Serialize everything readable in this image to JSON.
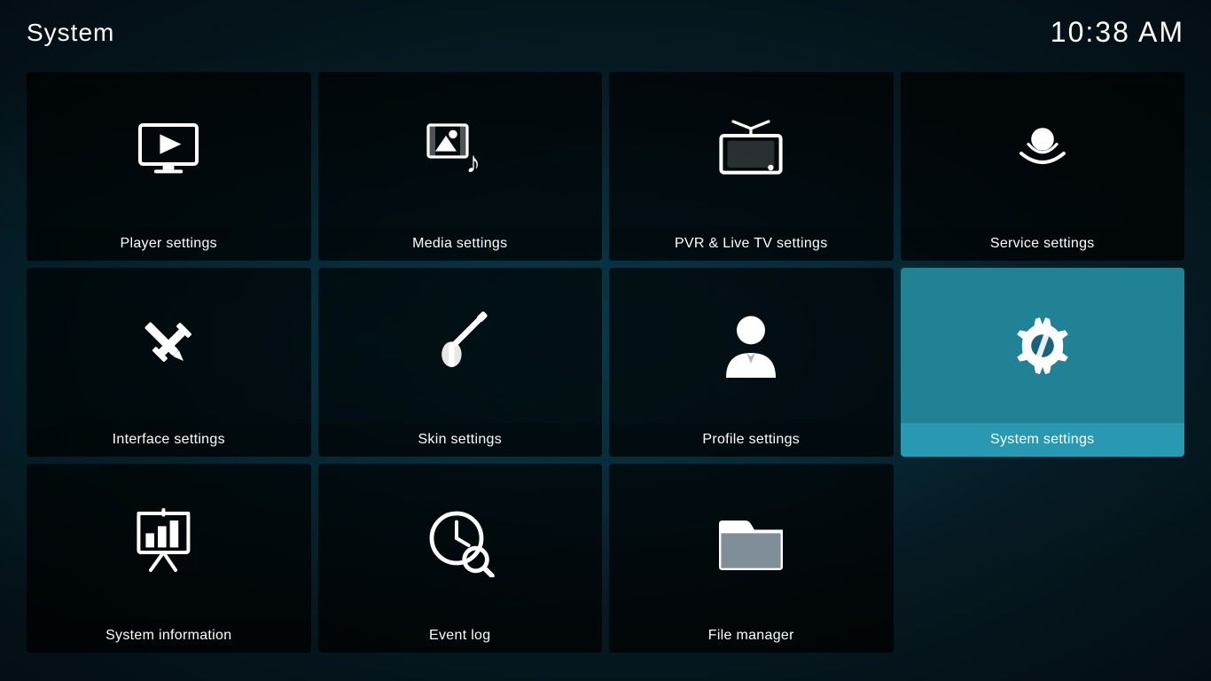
{
  "header": {
    "title": "System",
    "time": "10:38 AM"
  },
  "grid": {
    "items": [
      {
        "id": "player-settings",
        "label": "Player settings",
        "icon": "player",
        "active": false,
        "row": 1,
        "col": 1
      },
      {
        "id": "media-settings",
        "label": "Media settings",
        "icon": "media",
        "active": false,
        "row": 1,
        "col": 2
      },
      {
        "id": "pvr-settings",
        "label": "PVR & Live TV settings",
        "icon": "pvr",
        "active": false,
        "row": 1,
        "col": 3
      },
      {
        "id": "service-settings",
        "label": "Service settings",
        "icon": "service",
        "active": false,
        "row": 1,
        "col": 4
      },
      {
        "id": "interface-settings",
        "label": "Interface settings",
        "icon": "interface",
        "active": false,
        "row": 2,
        "col": 1
      },
      {
        "id": "skin-settings",
        "label": "Skin settings",
        "icon": "skin",
        "active": false,
        "row": 2,
        "col": 2
      },
      {
        "id": "profile-settings",
        "label": "Profile settings",
        "icon": "profile",
        "active": false,
        "row": 2,
        "col": 3
      },
      {
        "id": "system-settings",
        "label": "System settings",
        "icon": "system",
        "active": true,
        "row": 2,
        "col": 4
      },
      {
        "id": "system-information",
        "label": "System information",
        "icon": "information",
        "active": false,
        "row": 3,
        "col": 1
      },
      {
        "id": "event-log",
        "label": "Event log",
        "icon": "eventlog",
        "active": false,
        "row": 3,
        "col": 2
      },
      {
        "id": "file-manager",
        "label": "File manager",
        "icon": "filemanager",
        "active": false,
        "row": 3,
        "col": 3
      },
      {
        "id": "empty",
        "label": "",
        "icon": "none",
        "active": false,
        "row": 3,
        "col": 4
      }
    ]
  }
}
